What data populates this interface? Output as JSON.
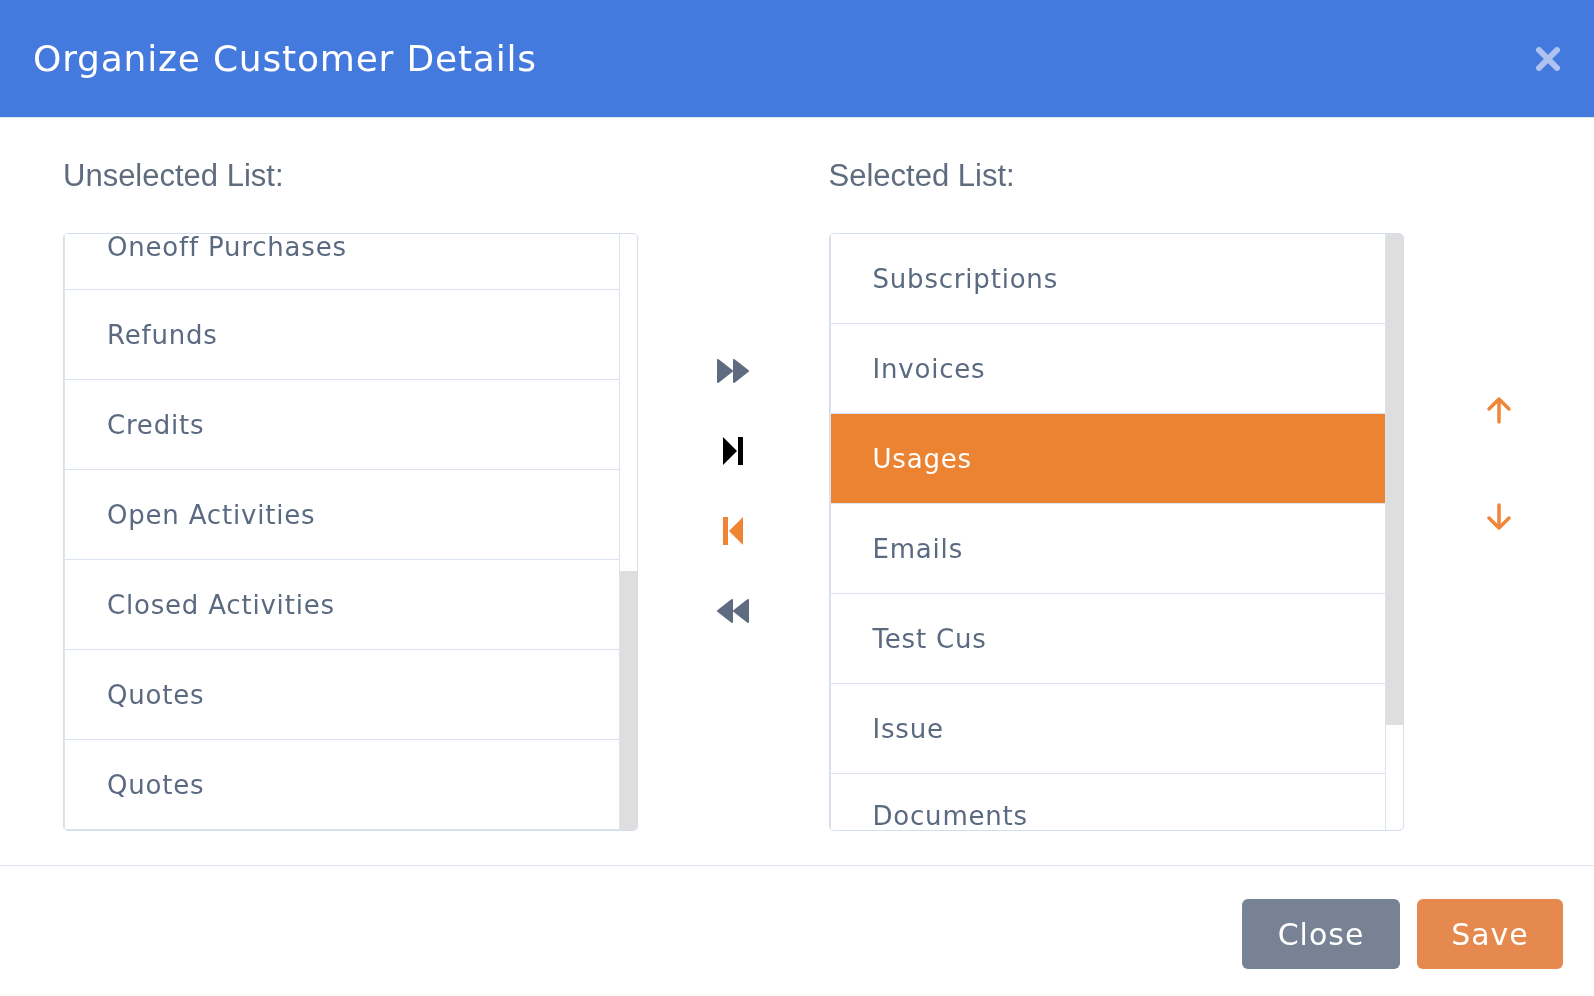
{
  "dialog": {
    "title": "Organize Customer Details"
  },
  "unselected_list": {
    "label": "Unselected List:",
    "items": [
      {
        "label": "Oneoff Purchases",
        "selected": false
      },
      {
        "label": "Refunds",
        "selected": false
      },
      {
        "label": "Credits",
        "selected": false
      },
      {
        "label": "Open Activities",
        "selected": false
      },
      {
        "label": "Closed Activities",
        "selected": false
      },
      {
        "label": "Quotes",
        "selected": false
      },
      {
        "label": "Quotes",
        "selected": false
      }
    ]
  },
  "transfer_buttons": [
    {
      "kind": "all_right",
      "color": "#5f6b80"
    },
    {
      "kind": "right",
      "color": "#000000"
    },
    {
      "kind": "left",
      "color": "#ee8434"
    },
    {
      "kind": "all_left",
      "color": "#5f6b80"
    }
  ],
  "selected_list": {
    "label": "Selected List:",
    "items": [
      {
        "label": "Subscriptions",
        "selected": false
      },
      {
        "label": "Invoices",
        "selected": false
      },
      {
        "label": "Usages",
        "selected": true
      },
      {
        "label": "Emails",
        "selected": false
      },
      {
        "label": "Test Cus",
        "selected": false
      },
      {
        "label": "Issue",
        "selected": false
      },
      {
        "label": "Documents",
        "selected": false
      }
    ]
  },
  "order_buttons": [
    {
      "kind": "up"
    },
    {
      "kind": "down"
    }
  ],
  "footer_buttons": [
    {
      "label": "Close",
      "kind": "secondary"
    },
    {
      "label": "Save",
      "kind": "primary"
    }
  ]
}
